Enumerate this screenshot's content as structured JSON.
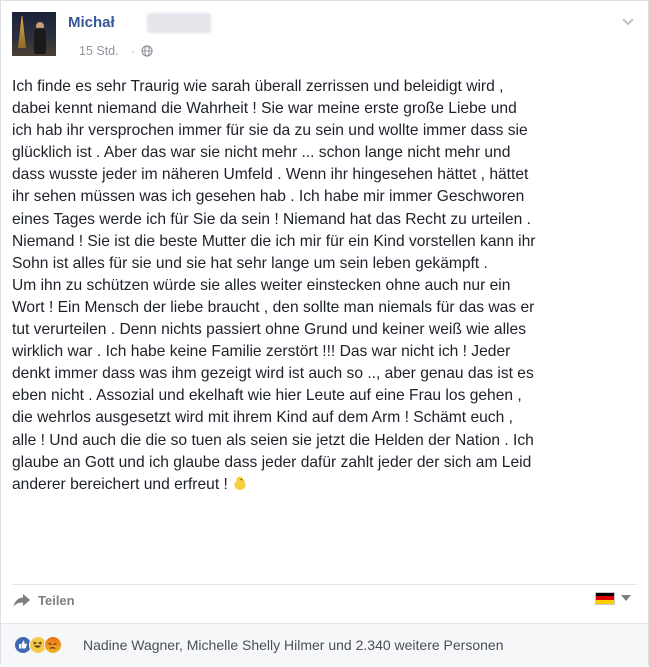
{
  "post": {
    "author": "Michał",
    "time": "15 Std.",
    "separator": "·",
    "lines": [
      "Ich finde es sehr Traurig wie sarah überall zerrissen und beleidigt wird ,",
      "dabei kennt niemand die Wahrheit ! Sie war meine erste große Liebe und",
      "ich hab ihr versprochen immer für sie da zu sein und wollte immer dass sie",
      "glücklich ist . Aber das war sie nicht mehr ... schon lange nicht mehr und",
      "dass wusste jeder im näheren Umfeld . Wenn ihr hingesehen hättet , hättet",
      "ihr sehen müssen was ich gesehen hab . Ich habe mir immer Geschworen",
      "eines Tages werde ich für Sie da sein ! Niemand hat das Recht zu urteilen .",
      "Niemand ! Sie ist die beste Mutter die ich mir für ein Kind vorstellen kann ihr",
      "Sohn ist alles für sie und sie hat sehr lange um sein leben gekämpft .",
      "Um ihn zu schützen würde sie alles weiter einstecken ohne auch nur ein",
      "Wort ! Ein Mensch der liebe braucht , den sollte man niemals für das was er",
      "tut verurteilen . Denn nichts passiert ohne Grund und keiner weiß wie alles",
      "wirklich war . Ich habe keine Familie zerstört !!! Das war nicht ich ! Jeder",
      "denkt immer dass was ihm gezeigt wird ist auch so .., aber genau das ist es",
      "eben nicht . Assozial und ekelhaft wie hier Leute auf eine Frau los gehen ,",
      "die wehrlos ausgesetzt wird mit ihrem Kind auf dem Arm ! Schämt euch ,",
      "alle ! Und auch die die so tuen als seien sie jetzt die Helden der Nation . Ich",
      "glaube an Gott und ich glaube dass jeder dafür zahlt jeder der sich am Leid",
      "anderer bereichert und erfreut !"
    ]
  },
  "actions": {
    "share_label": "Teilen"
  },
  "reactions": {
    "icons": [
      "like-icon",
      "haha-icon",
      "angry-icon"
    ],
    "summary": "Nadine Wagner, Michelle Shelly Hilmer und 2.340 weitere Personen"
  },
  "colors": {
    "link": "#365899",
    "meta": "#90949c",
    "text": "#1d2129",
    "flag": [
      "#000000",
      "#dd0000",
      "#ffce00"
    ]
  }
}
